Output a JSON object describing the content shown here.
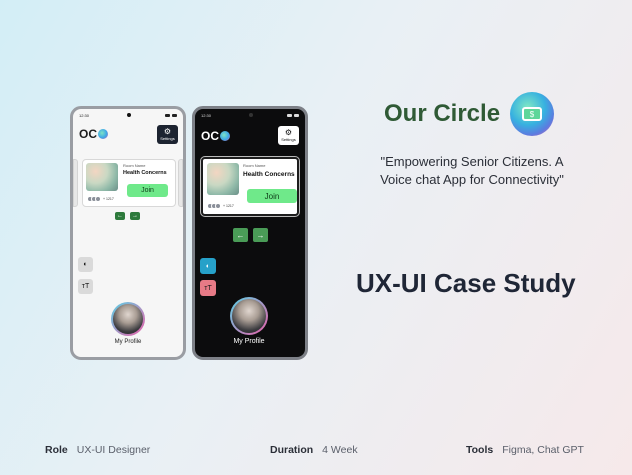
{
  "brand": {
    "title": "Our Circle",
    "tagline_line1": "\"Empowering Senior Citizens. A",
    "tagline_line2": "Voice chat App for Connectivity\"",
    "case_study": "UX-UI Case Study",
    "icon": "money-chat-icon"
  },
  "phone_light": {
    "time": "12:30",
    "logo": "OC",
    "settings_label": "Settings",
    "room_name_label": "Room Name",
    "room_title": "Health Concerns",
    "join_label": "Join",
    "members": "+ 1217",
    "profile_label": "My Profile",
    "contrast_icon": "◐",
    "text_size_icon": "тT"
  },
  "phone_dark": {
    "time": "12:30",
    "logo": "OC",
    "settings_label": "Settings",
    "room_name_label": "Room Name",
    "room_title": "Health Concerns",
    "join_label": "Join",
    "members": "+ 1217",
    "profile_label": "My Profile",
    "contrast_icon": "◐",
    "text_size_icon": "тT"
  },
  "footer": {
    "role_label": "Role",
    "role_value": "UX-UI Designer",
    "duration_label": "Duration",
    "duration_value": "4 Week",
    "tools_label": "Tools",
    "tools_value": "Figma, Chat GPT"
  },
  "colors": {
    "brand_green": "#2f5a35",
    "join_green": "#6fe98a",
    "nav_green": "#2d7a3c",
    "dark_contrast_toggle": "#26a1c9",
    "dark_textsize_toggle": "#e77a86"
  }
}
